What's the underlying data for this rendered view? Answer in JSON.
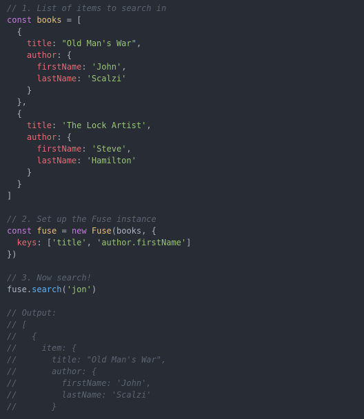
{
  "code": {
    "c1": "// 1. List of items to search in",
    "kw_const1": "const",
    "var_books": "books",
    "eq1": " = [",
    "ob1": "  {",
    "p_title1": "title",
    "s_title1": "\"Old Man's War\"",
    "p_author1": "author",
    "ob_author1": ": {",
    "p_fn1": "firstName",
    "s_fn1": "'John'",
    "p_ln1": "lastName",
    "s_ln1": "'Scalzi'",
    "cb1": "    }",
    "cb1b": "  },",
    "ob2": "  {",
    "p_title2": "title",
    "s_title2": "'The Lock Artist'",
    "p_author2": "author",
    "ob_author2": ": {",
    "p_fn2": "firstName",
    "s_fn2": "'Steve'",
    "p_ln2": "lastName",
    "s_ln2": "'Hamilton'",
    "cb2": "    }",
    "cb2b": "  }",
    "close_arr": "]",
    "c2": "// 2. Set up the Fuse instance",
    "kw_const2": "const",
    "var_fuse": "fuse",
    "kw_new": "new",
    "cls_fuse": "Fuse",
    "callargs_open": "(books, {",
    "p_keys": "keys",
    "s_k1": "'title'",
    "s_k2": "'author.firstName'",
    "close_obj": "})",
    "c3": "// 3. Now search!",
    "m_search": "search",
    "s_jon": "'jon'",
    "out1": "// Output:",
    "out2": "// [",
    "out3": "//   {",
    "out4": "//     item: {",
    "out5": "//       title: \"Old Man's War\",",
    "out6": "//       author: {",
    "out7": "//         firstName: 'John',",
    "out8": "//         lastName: 'Scalzi'",
    "out9": "//       }"
  }
}
